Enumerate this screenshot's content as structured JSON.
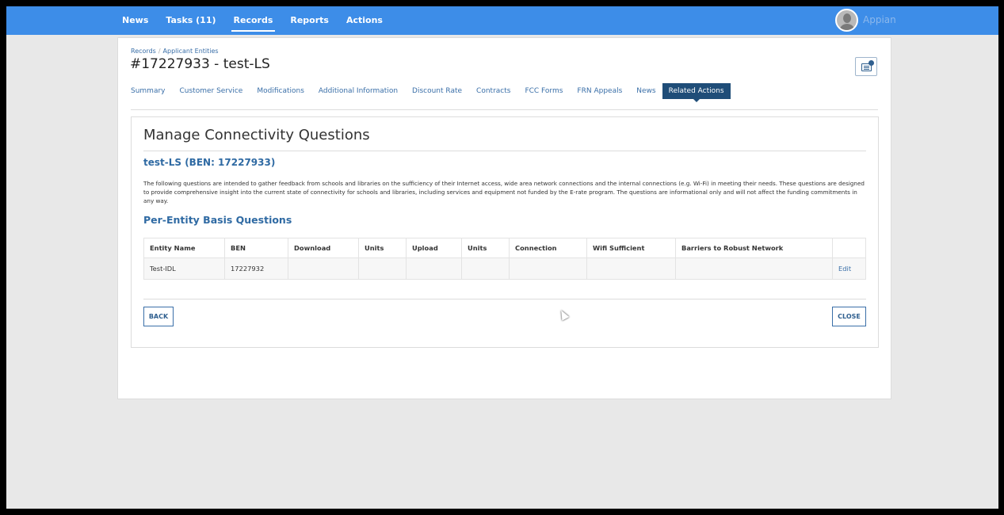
{
  "nav": {
    "items": [
      "News",
      "Tasks (11)",
      "Records",
      "Reports",
      "Actions"
    ],
    "active": "Records",
    "brand": "Appian"
  },
  "breadcrumb": [
    "Records",
    "Applicant Entities"
  ],
  "record_title": "#17227933 - test-LS",
  "record_tabs": [
    "Summary",
    "Customer Service",
    "Modifications",
    "Additional Information",
    "Discount Rate",
    "Contracts",
    "FCC Forms",
    "FRN Appeals",
    "News",
    "Related Actions"
  ],
  "active_tab": "Related Actions",
  "form": {
    "title": "Manage Connectivity Questions",
    "entity_heading": "test-LS (BEN: 17227933)",
    "description": "The following questions are intended to gather feedback from schools and libraries on the sufficiency of their Internet access, wide area network connections and the internal connections (e.g. Wi-Fi) in meeting their needs. These questions are designed to provide comprehensive insight into the current state of connectivity for schools and libraries, including services and equipment not funded by the E-rate program. The questions are informational only and will not affect the funding commitments in any way.",
    "basis_heading": "Per-Entity Basis Questions",
    "columns": [
      "Entity Name",
      "BEN",
      "Download",
      "Units",
      "Upload",
      "Units",
      "Connection",
      "Wifi Sufficient",
      "Barriers to Robust Network",
      ""
    ],
    "rows": [
      [
        "Test-IDL",
        "17227932",
        "",
        "",
        "",
        "",
        "",
        "",
        "",
        "Edit"
      ]
    ],
    "back_label": "BACK",
    "close_label": "CLOSE"
  },
  "icons": {
    "avatar": "user-avatar-icon",
    "tasks": "record-tasks-icon",
    "cursor": "mouse-pointer-icon"
  }
}
